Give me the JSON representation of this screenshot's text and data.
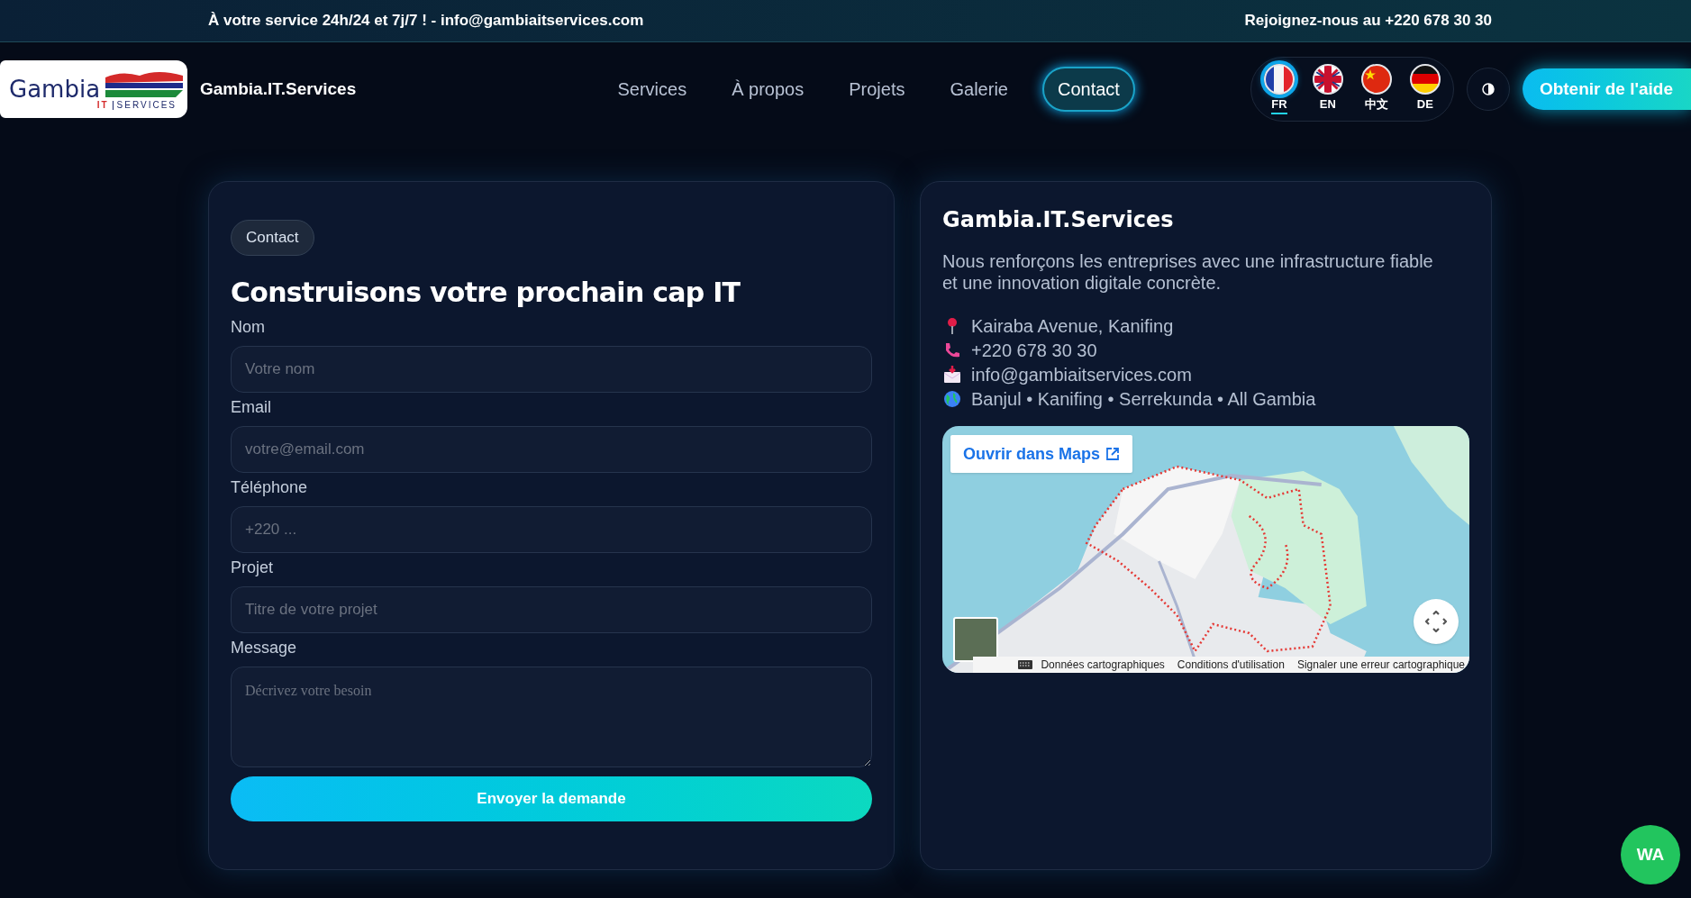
{
  "top_bar": {
    "left": "À votre service 24h/24 et 7j/7 ! - info@gambiaitservices.com",
    "right": "Rejoignez-nous au +220 678 30 30"
  },
  "header": {
    "logo": {
      "name": "Gambia",
      "tag_left": "IT",
      "tag_right": "SERVICES"
    },
    "brand": "Gambia.IT.Services",
    "nav": [
      {
        "label": "Services",
        "selected": false
      },
      {
        "label": "À propos",
        "selected": false
      },
      {
        "label": "Projets",
        "selected": false
      },
      {
        "label": "Galerie",
        "selected": false
      },
      {
        "label": "Contact",
        "selected": true
      }
    ],
    "languages": [
      {
        "code": "FR",
        "kind": "fr",
        "selected": true
      },
      {
        "code": "EN",
        "kind": "gb",
        "selected": false
      },
      {
        "code": "中文",
        "kind": "cn",
        "selected": false
      },
      {
        "code": "DE",
        "kind": "de",
        "selected": false
      }
    ],
    "cta": "Obtenir de l'aide"
  },
  "form": {
    "badge": "Contact",
    "title": "Construisons votre prochain cap IT",
    "fields": [
      {
        "label": "Nom",
        "placeholder": "Votre nom",
        "kind": "input"
      },
      {
        "label": "Email",
        "placeholder": "votre@email.com",
        "kind": "input"
      },
      {
        "label": "Téléphone",
        "placeholder": "+220 ...",
        "kind": "input"
      },
      {
        "label": "Projet",
        "placeholder": "Titre de votre projet",
        "kind": "input"
      },
      {
        "label": "Message",
        "placeholder": "Décrivez votre besoin",
        "kind": "textarea"
      }
    ],
    "submit": "Envoyer la demande"
  },
  "info": {
    "title": "Gambia.IT.Services",
    "description": "Nous renforçons les entreprises avec une infrastructure fiable et une innovation digitale concrète.",
    "contacts": [
      {
        "kind": "address",
        "text": "Kairaba Avenue, Kanifing"
      },
      {
        "kind": "phone",
        "text": "+220 678 30 30"
      },
      {
        "kind": "email",
        "text": "info@gambiaitservices.com"
      },
      {
        "kind": "area",
        "text": "Banjul • Kanifing • Serrekunda • All Gambia"
      }
    ],
    "map": {
      "open_button": "Ouvrir dans Maps",
      "attribution": [
        "Données cartographiques",
        "Conditions d'utilisation",
        "Signaler une erreur cartographique"
      ]
    }
  },
  "whatsapp": "WA"
}
